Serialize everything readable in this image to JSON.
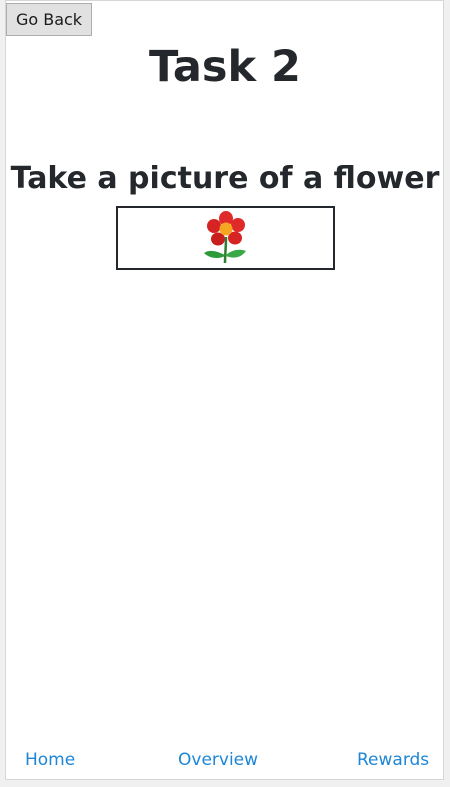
{
  "header": {
    "back_label": "Go Back",
    "title": "Task 2"
  },
  "task": {
    "instruction": "Take a picture of a flower",
    "camera_icon": "flower-icon"
  },
  "nav": {
    "home": "Home",
    "overview": "Overview",
    "rewards": "Rewards"
  },
  "colors": {
    "text": "#24272b",
    "link": "#1e86d6",
    "button_bg": "#e1e1e1",
    "petal": "#e02a2a",
    "flower_center": "#f5a623",
    "leaf": "#2e9a3a"
  }
}
